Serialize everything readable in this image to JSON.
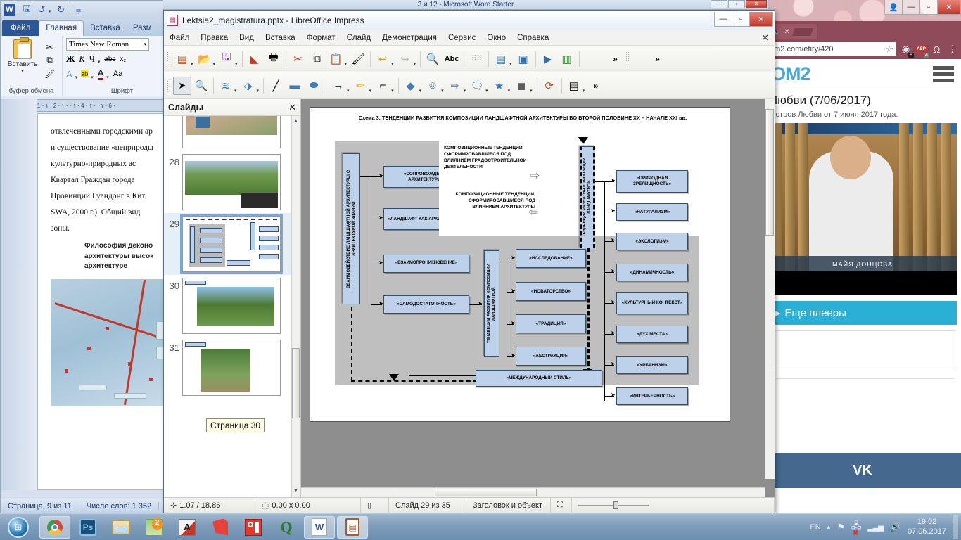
{
  "word": {
    "app_logo": "W",
    "qat": [
      {
        "name": "save-icon",
        "glyph": "💾"
      },
      {
        "name": "undo-icon",
        "glyph": "↺"
      },
      {
        "name": "redo-icon",
        "glyph": "↻"
      },
      {
        "name": "customize-qat-icon",
        "glyph": "▾"
      }
    ],
    "title": "3 и 12 - Microsoft Word Starter",
    "tabs": [
      {
        "label": "Файл",
        "state": "file"
      },
      {
        "label": "Главная",
        "state": "active"
      },
      {
        "label": "Вставка",
        "state": ""
      },
      {
        "label": "Разм",
        "state": ""
      }
    ],
    "clipboard": {
      "paste_label": "Вставить",
      "group_label": "буфер обмена",
      "cut_icon": "✂",
      "copy_icon": "⧉",
      "format_painter_icon": "🖌"
    },
    "font": {
      "group_label": "Шрифт",
      "font_name": "Times New Roman",
      "bold": "Ж",
      "italic": "К",
      "underline": "Ч",
      "strikethrough": "abc",
      "subscript": "x₂",
      "text_effects": "A",
      "highlight": "ab",
      "font_color": "A",
      "change_case": "Aa"
    },
    "ruler_marks": "· 1 · ۱ · 2 · ۱ · · ۱ · 4 · ۱ · · ۱ · 6 ·",
    "corner_tab": "⌐",
    "document_lines": [
      "отвлеченными городскими ар",
      "и существование «неприроды",
      "культурно-природных     ас",
      "Квартал   Граждан   города",
      "Провинции  Гуандонг   в Кит",
      "SWA,  2000  г.).    Общий вид",
      "зоны."
    ],
    "document_heading": "Философия деконо\nархитектуры высок\nархитектуре",
    "status": {
      "page": "Страница: 9 из 11",
      "words": "Число слов: 1 352"
    }
  },
  "browser": {
    "window_buttons": {
      "user": "👤",
      "minimize": "—",
      "maximize": "▫",
      "close": "✕"
    },
    "tab": {
      "mute_icon": "🔈",
      "close_icon": "✕"
    },
    "url": "om2.com/efiry/420",
    "bookmark_icon": "☆",
    "extensions": [
      {
        "name": "ghostery-icon",
        "glyph": "◉",
        "badge": "8"
      },
      {
        "name": "adblock-plus-icon",
        "glyph": "ABP",
        "badge": "4"
      },
      {
        "name": "puzzle-icon",
        "glyph": "Ω",
        "badge": ""
      },
      {
        "name": "chrome-menu-icon",
        "glyph": "⋮",
        "badge": ""
      }
    ],
    "site_logo": "OM2",
    "menu_icon": "hamburger-icon",
    "post_title": "Любви (7/06/2017)",
    "post_subtitle": "Остров Любви от 7 июня 2017 года.",
    "video_caption": "МАЙЯ ДОНЦОВА",
    "more_players": "Еще плееры",
    "more_players_arrow": "▸",
    "vk_logo": "VK"
  },
  "impress": {
    "title": "Lektsia2_magistratura.pptx - LibreOffice Impress",
    "window_buttons": {
      "minimize": "—",
      "maximize": "▫",
      "close": "✕"
    },
    "menu": [
      "Файл",
      "Правка",
      "Вид",
      "Вставка",
      "Формат",
      "Слайд",
      "Демонстрация",
      "Сервис",
      "Окно",
      "Справка"
    ],
    "menu_close": "✕",
    "toolbar_standard": [
      {
        "name": "new-document-icon",
        "glyph": "📄",
        "caret": true
      },
      {
        "name": "open-icon",
        "glyph": "📂",
        "caret": true
      },
      {
        "name": "save-icon",
        "glyph": "💾",
        "caret": true
      },
      {
        "name": "export-pdf-icon",
        "glyph": "📕",
        "caret": false
      },
      {
        "name": "print-icon",
        "glyph": "🖨",
        "caret": false
      },
      {
        "name": "cut-icon",
        "glyph": "✂",
        "caret": false
      },
      {
        "name": "copy-icon",
        "glyph": "⧉",
        "caret": false
      },
      {
        "name": "paste-icon",
        "glyph": "📋",
        "caret": true
      },
      {
        "name": "clone-formatting-icon",
        "glyph": "🖌",
        "caret": false
      },
      {
        "name": "undo-icon",
        "glyph": "↩",
        "caret": true
      },
      {
        "name": "redo-icon",
        "glyph": "↪",
        "caret": true
      },
      {
        "name": "find-replace-icon",
        "glyph": "🔍",
        "caret": false
      },
      {
        "name": "spelling-icon",
        "glyph": "Abc",
        "caret": false
      },
      {
        "name": "display-grid-icon",
        "glyph": "⠿",
        "caret": false
      },
      {
        "name": "master-slide-icon",
        "glyph": "▤",
        "caret": true
      },
      {
        "name": "display-views-icon",
        "glyph": "▣",
        "caret": false
      },
      {
        "name": "start-from-first-slide-icon",
        "glyph": "▶",
        "caret": false
      },
      {
        "name": "start-from-current-slide-icon",
        "glyph": "▥",
        "caret": false
      },
      {
        "name": "toolbar-overflow-icon",
        "glyph": "»",
        "caret": false
      }
    ],
    "toolbar_drawing": [
      {
        "name": "select-icon",
        "glyph": "⌖",
        "caret": false,
        "selected": true
      },
      {
        "name": "zoom-icon",
        "glyph": "🔍",
        "caret": false
      },
      {
        "name": "line-color-icon",
        "glyph": "≋",
        "caret": true
      },
      {
        "name": "fill-color-icon",
        "glyph": "🪣",
        "caret": true
      },
      {
        "name": "insert-line-icon",
        "glyph": "╱",
        "caret": false
      },
      {
        "name": "rectangle-icon",
        "glyph": "▭",
        "caret": false
      },
      {
        "name": "ellipse-icon",
        "glyph": "⬭",
        "caret": false
      },
      {
        "name": "arrow-icon",
        "glyph": "→",
        "caret": true
      },
      {
        "name": "curve-icon",
        "glyph": "✏",
        "caret": true
      },
      {
        "name": "connector-icon",
        "glyph": "⌐",
        "caret": true
      },
      {
        "name": "basic-shapes-icon",
        "glyph": "◆",
        "caret": true
      },
      {
        "name": "smiley-shapes-icon",
        "glyph": "☺",
        "caret": true
      },
      {
        "name": "block-arrows-icon",
        "glyph": "⇨",
        "caret": true
      },
      {
        "name": "callout-shapes-icon",
        "glyph": "💬",
        "caret": true
      },
      {
        "name": "stars-icon",
        "glyph": "★",
        "caret": true
      },
      {
        "name": "3d-objects-icon",
        "glyph": "◼",
        "caret": true
      },
      {
        "name": "rotate-icon",
        "glyph": "⟳",
        "caret": false
      },
      {
        "name": "align-icon",
        "glyph": "▤",
        "caret": true
      },
      {
        "name": "toolbar-overflow-icon",
        "glyph": "»",
        "caret": false
      }
    ],
    "slide_panel": {
      "title": "Слайды",
      "close_icon": "✕",
      "slides": [
        {
          "number": "",
          "active": false
        },
        {
          "number": "28",
          "active": false
        },
        {
          "number": "29",
          "active": true
        },
        {
          "number": "30",
          "active": false
        },
        {
          "number": "31",
          "active": false
        }
      ],
      "tooltip": "Страница 30"
    },
    "status": {
      "position": "1.07 / 18.86",
      "size": "0.00 x 0.00",
      "slide_count": "Слайд 29 из 35",
      "layout": "Заголовок и объект",
      "pos_icon": "⊹",
      "size_icon": "⬚",
      "mod_icon": "▯",
      "fit_icon": "⛶"
    }
  },
  "diagram": {
    "title": "Схема 3. ТЕНДЕНЦИИ РАЗВИТИЯ КОМПОЗИЦИИ ЛАНДШАФТНОЙ АРХИТЕКТУРЫ ВО ВТОРОЙ ПОЛОВИНЕ XX – НАЧАЛЕ XXI вв.",
    "left_axis_label": "ВЗАИМОДЕЙСТВИЕ ЛАНДШАФТНОЙ АРХИТЕКТУРЫ С АРХИТЕКТУРОЙ ЗДАНИЙ",
    "right_axis_label": "ТЕНДЕНЦИИ  РАЗВИТИЯ КОМПОЗИЦИИ ЛАНДШАФТНОЙ",
    "mid_axis_label": "ТЕНДЕНЦИИ  РАЗВИТИЯ КОМПОЗИЦИИ ЛАНДШАФТНОЙ",
    "interaction_boxes": [
      "«СОПРОВОЖДЕНИЕ АРХИТЕКТУРЫ»",
      "«ЛАНДШАФТ КАК АРХИТЕКТУРА »",
      "«ВЗАИМОПРОНИКНОВЕНИЕ»",
      "«САМОДОСТАТОЧНОСТЬ»"
    ],
    "note_top": "КОМПОЗИЦИОННЫЕ ТЕНДЕНЦИИ, СФОРМИРОВАВШИЕСЯ ПОД ВЛИЯНИЕМ ГРАДОСТРОИТЕЛЬНОЙ ДЕЯТЕЛЬНОСТИ",
    "note_bottom": "КОМПОЗИЦИОННЫЕ ТЕНДЕНЦИИ, СФОРМИРОВАВШИЕСЯ ПОД ВЛИЯНИЕМ АРХИТЕКТУРЫ",
    "center_boxes": [
      "«ИССЛЕДОВАНИЕ»",
      "«НОВАТОРСТВО»",
      "«ТРАДИЦИЯ»",
      "«АБСТРАКЦИЯ»"
    ],
    "right_boxes": [
      "«ПРИРОДНАЯ ЗРЕЛИЩНОСТЬ»",
      "«НАТУРАЛИЗМ»",
      "«ЭКОЛОГИЗМ»",
      "«ДИНАМИЧНОСТЬ»",
      "«КУЛЬТУРНЫЙ КОНТЕКСТ»",
      "«ДУХ МЕСТА»",
      "«УРБАНИЗМ»",
      "«ИНТЕРЬЕРНОСТЬ»"
    ],
    "bottom_box": "«МЕЖДУНАРОДНЫЙ СТИЛЬ»"
  },
  "taskbar": {
    "start_icon": "start-orb-icon",
    "items": [
      {
        "name": "chrome-icon",
        "label": "Chrome"
      },
      {
        "name": "photoshop-icon",
        "label": "Ps"
      },
      {
        "name": "explorer-icon",
        "label": "Explorer"
      },
      {
        "name": "maps-icon",
        "label": "2GIS"
      },
      {
        "name": "autocad-icon",
        "label": "A"
      },
      {
        "name": "sketchup-icon",
        "label": "SU"
      },
      {
        "name": "reader-icon",
        "label": "Reader"
      },
      {
        "name": "quark-icon",
        "label": "Q"
      },
      {
        "name": "word-icon",
        "label": "W"
      },
      {
        "name": "impress-icon",
        "label": "Impress"
      }
    ],
    "tray": {
      "language": "EN",
      "show_hidden_icon": "▴",
      "flag_icon": "⚑",
      "action-center_icon": "✖",
      "network_icon": "▂▃▅",
      "volume_icon": "🔊",
      "time": "19:02",
      "date": "07.06.2017"
    }
  }
}
